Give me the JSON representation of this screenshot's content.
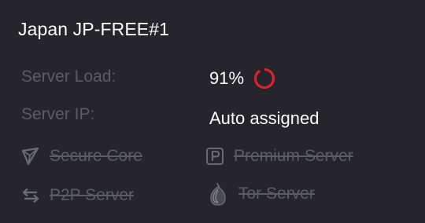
{
  "server": {
    "title": "Japan JP-FREE#1"
  },
  "details": {
    "load_label": "Server Load:",
    "load_value": "91%",
    "load_fraction": 0.91,
    "load_color": "#d9232c",
    "ip_label": "Server IP:",
    "ip_value": "Auto assigned"
  },
  "features": {
    "secure_core": {
      "label": "Secure Core",
      "icon": "secure-core-icon"
    },
    "premium": {
      "label": "Premium Server",
      "icon": "premium-p-icon"
    },
    "p2p": {
      "label": "P2P Server",
      "icon": "p2p-arrows-icon"
    },
    "tor": {
      "label": "Tor Server",
      "icon": "tor-onion-icon"
    }
  }
}
